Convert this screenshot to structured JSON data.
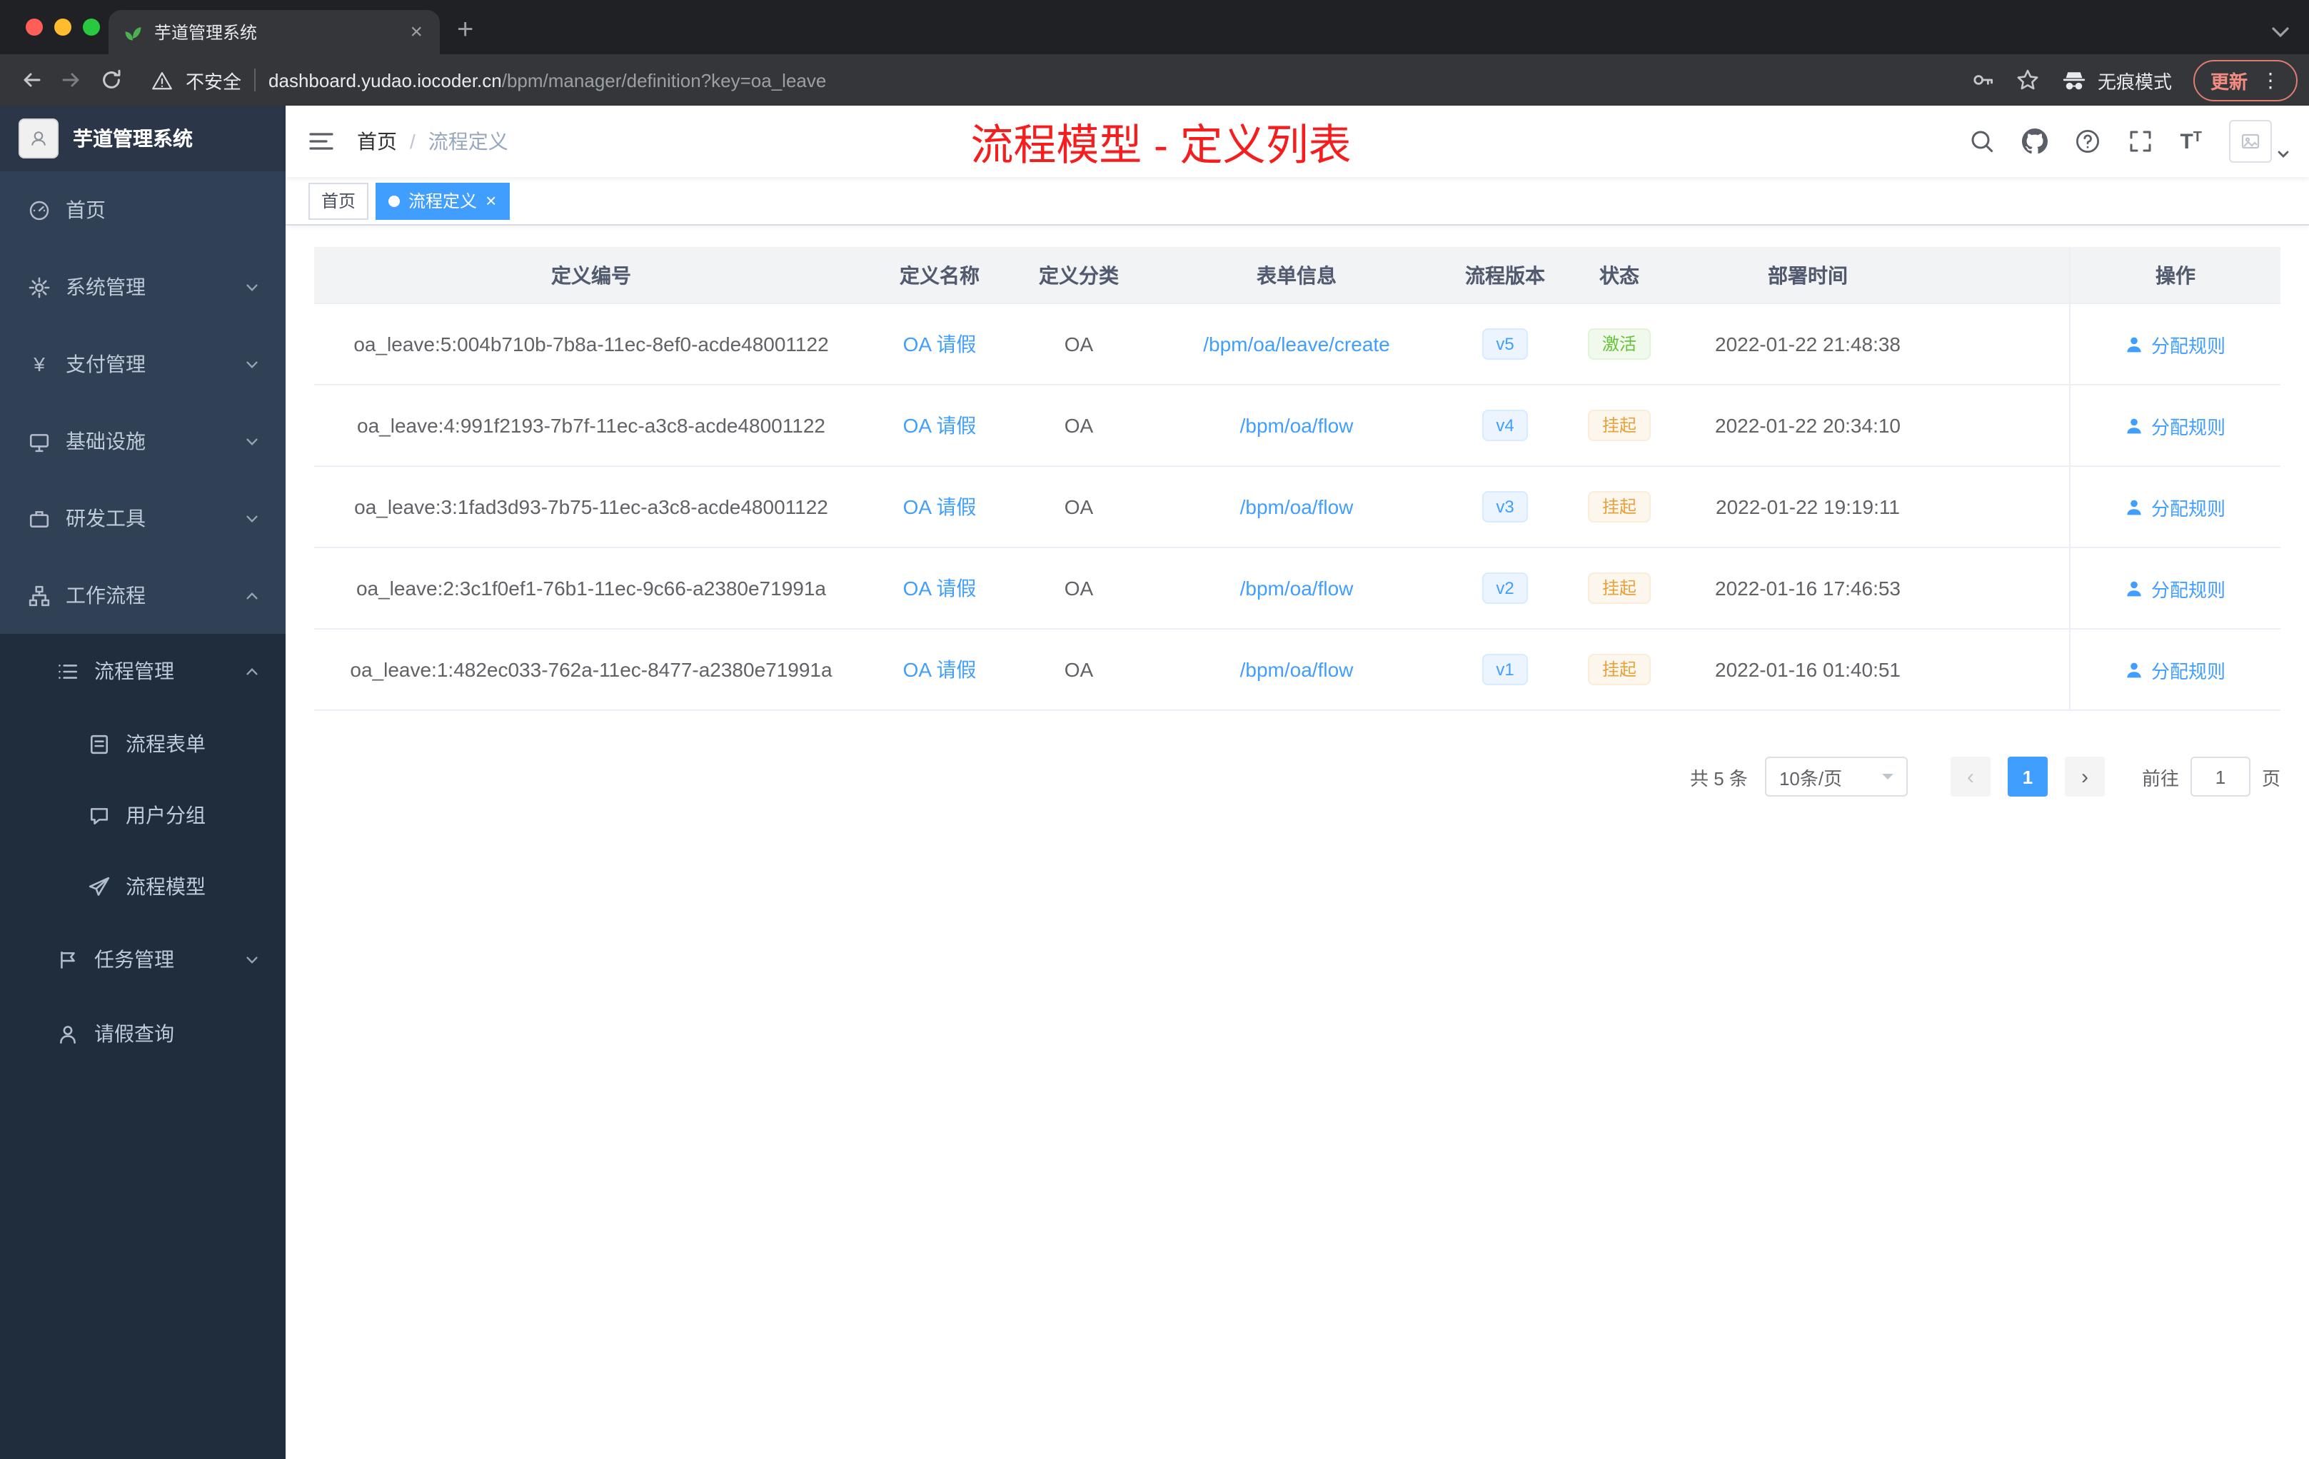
{
  "colors": {
    "accent": "#409eff",
    "success": "#67c23a",
    "warning": "#e6a23c",
    "annotation_red": "#f51d1d",
    "sidebar_bg": "#304156",
    "sidebar_submenu_bg": "#1f2d3d"
  },
  "browser": {
    "tab_title": "芋道管理系统",
    "security_label": "不安全",
    "url_host": "dashboard.yudao.iocoder.cn",
    "url_path": "/bpm/manager/definition?key=oa_leave",
    "incognito_label": "无痕模式",
    "update_label": "更新"
  },
  "sidebar": {
    "logo_title": "芋道管理系统",
    "menu": [
      {
        "label": "首页"
      },
      {
        "label": "系统管理"
      },
      {
        "label": "支付管理"
      },
      {
        "label": "基础设施"
      },
      {
        "label": "研发工具"
      },
      {
        "label": "工作流程"
      },
      {
        "label": "流程管理"
      },
      {
        "label": "流程表单"
      },
      {
        "label": "用户分组"
      },
      {
        "label": "流程模型"
      },
      {
        "label": "任务管理"
      },
      {
        "label": "请假查询"
      }
    ]
  },
  "navbar": {
    "breadcrumb_home": "首页",
    "breadcrumb_separator": "/",
    "breadcrumb_current": "流程定义",
    "annotation": "流程模型 - 定义列表"
  },
  "tags": {
    "home": "首页",
    "current": "流程定义"
  },
  "table": {
    "columns": [
      "定义编号",
      "定义名称",
      "定义分类",
      "表单信息",
      "流程版本",
      "状态",
      "部署时间",
      "操作"
    ],
    "action_label": "分配规则",
    "rows": [
      {
        "id": "oa_leave:5:004b710b-7b8a-11ec-8ef0-acde48001122",
        "name": "OA 请假",
        "category": "OA",
        "form": "/bpm/oa/leave/create",
        "version": "v5",
        "status": "激活",
        "status_type": "success",
        "deploy_time": "2022-01-22 21:48:38"
      },
      {
        "id": "oa_leave:4:991f2193-7b7f-11ec-a3c8-acde48001122",
        "name": "OA 请假",
        "category": "OA",
        "form": "/bpm/oa/flow",
        "version": "v4",
        "status": "挂起",
        "status_type": "warning",
        "deploy_time": "2022-01-22 20:34:10"
      },
      {
        "id": "oa_leave:3:1fad3d93-7b75-11ec-a3c8-acde48001122",
        "name": "OA 请假",
        "category": "OA",
        "form": "/bpm/oa/flow",
        "version": "v3",
        "status": "挂起",
        "status_type": "warning",
        "deploy_time": "2022-01-22 19:19:11"
      },
      {
        "id": "oa_leave:2:3c1f0ef1-76b1-11ec-9c66-a2380e71991a",
        "name": "OA 请假",
        "category": "OA",
        "form": "/bpm/oa/flow",
        "version": "v2",
        "status": "挂起",
        "status_type": "warning",
        "deploy_time": "2022-01-16 17:46:53"
      },
      {
        "id": "oa_leave:1:482ec033-762a-11ec-8477-a2380e71991a",
        "name": "OA 请假",
        "category": "OA",
        "form": "/bpm/oa/flow",
        "version": "v1",
        "status": "挂起",
        "status_type": "warning",
        "deploy_time": "2022-01-16 01:40:51"
      }
    ]
  },
  "pagination": {
    "total": "共 5 条",
    "page_size": "10条/页",
    "current_page": "1",
    "goto_label": "前往",
    "goto_value": "1",
    "goto_suffix": "页"
  },
  "icons": {
    "browser": [
      "back-icon",
      "forward-icon",
      "reload-icon",
      "warning-triangle-icon",
      "key-icon",
      "bookmark-star-icon",
      "incognito-icon",
      "menu-dots-icon",
      "tab-search-icon"
    ],
    "navbar": [
      "hamburger-icon",
      "search-icon",
      "github-icon",
      "help-icon",
      "fullscreen-icon",
      "font-size-icon"
    ],
    "sidebar": [
      "dashboard-icon",
      "gear-icon",
      "yen-icon",
      "monitor-icon",
      "toolbox-icon",
      "workflow-icon",
      "list-icon",
      "form-icon",
      "chat-icon",
      "paper-plane-icon",
      "flag-icon",
      "person-icon"
    ]
  }
}
